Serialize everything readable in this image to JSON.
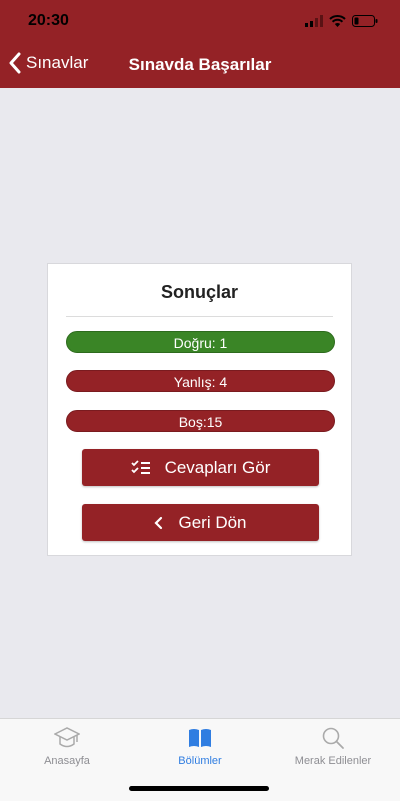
{
  "status_bar": {
    "time": "20:30"
  },
  "nav": {
    "back_label": "Sınavlar",
    "title": "Sınavda Başarılar"
  },
  "results": {
    "title": "Sonuçlar",
    "correct": "Doğru: 1",
    "wrong": "Yanlış: 4",
    "empty": "Boş:15",
    "view_answers": "Cevapları Gör",
    "go_back": "Geri Dön"
  },
  "tabs": [
    {
      "label": "Anasayfa",
      "icon": "graduation-cap-icon",
      "active": false
    },
    {
      "label": "Bölümler",
      "icon": "book-icon",
      "active": true
    },
    {
      "label": "Merak Edilenler",
      "icon": "search-icon",
      "active": false
    }
  ],
  "colors": {
    "brand": "#942226",
    "correct": "#3a8526",
    "tab_active": "#2f7de1",
    "tab_inactive": "#8e8e93"
  }
}
